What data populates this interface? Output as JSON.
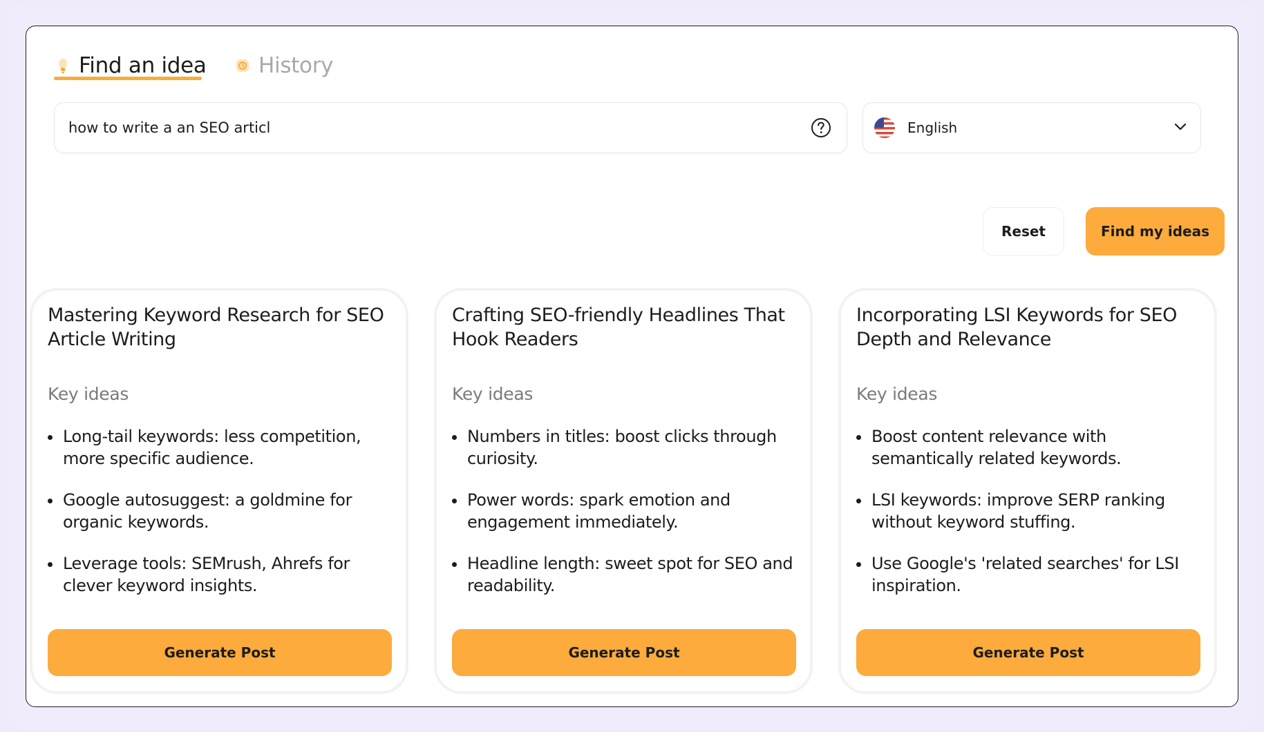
{
  "tabs": {
    "find": {
      "label": "Find an idea",
      "icon": "lightbulb-icon",
      "active": true
    },
    "history": {
      "label": "History",
      "icon": "history-icon",
      "active": false
    }
  },
  "search": {
    "value": "how to write a an SEO articl",
    "help_icon": "help-circle-icon"
  },
  "language": {
    "selected": "English",
    "flag_icon": "us-flag-icon",
    "dropdown_icon": "chevron-down-icon"
  },
  "actions": {
    "reset_label": "Reset",
    "find_label": "Find my ideas"
  },
  "cards": [
    {
      "title": "Mastering Keyword Research for SEO Article Writing",
      "key_label": "Key ideas",
      "ideas": [
        "Long-tail keywords: less competition, more specific audience.",
        "Google autosuggest: a goldmine for organic keywords.",
        "Leverage tools: SEMrush, Ahrefs for clever keyword insights."
      ],
      "button_label": "Generate Post"
    },
    {
      "title": "Crafting SEO-friendly Headlines That Hook Readers",
      "key_label": "Key ideas",
      "ideas": [
        "Numbers in titles: boost clicks through curiosity.",
        "Power words: spark emotion and engagement immediately.",
        "Headline length: sweet spot for SEO and readability."
      ],
      "button_label": "Generate Post"
    },
    {
      "title": "Incorporating LSI Keywords for SEO Depth and Relevance",
      "key_label": "Key ideas",
      "ideas": [
        "Boost content relevance with semantically related keywords.",
        "LSI keywords: improve SERP ranking without keyword stuffing.",
        "Use Google's 'related searches' for LSI inspiration."
      ],
      "button_label": "Generate Post"
    }
  ],
  "colors": {
    "accent": "#fcab3c",
    "background": "#efebfb",
    "panel": "#ffffff",
    "muted_text": "#a9a9a9"
  }
}
